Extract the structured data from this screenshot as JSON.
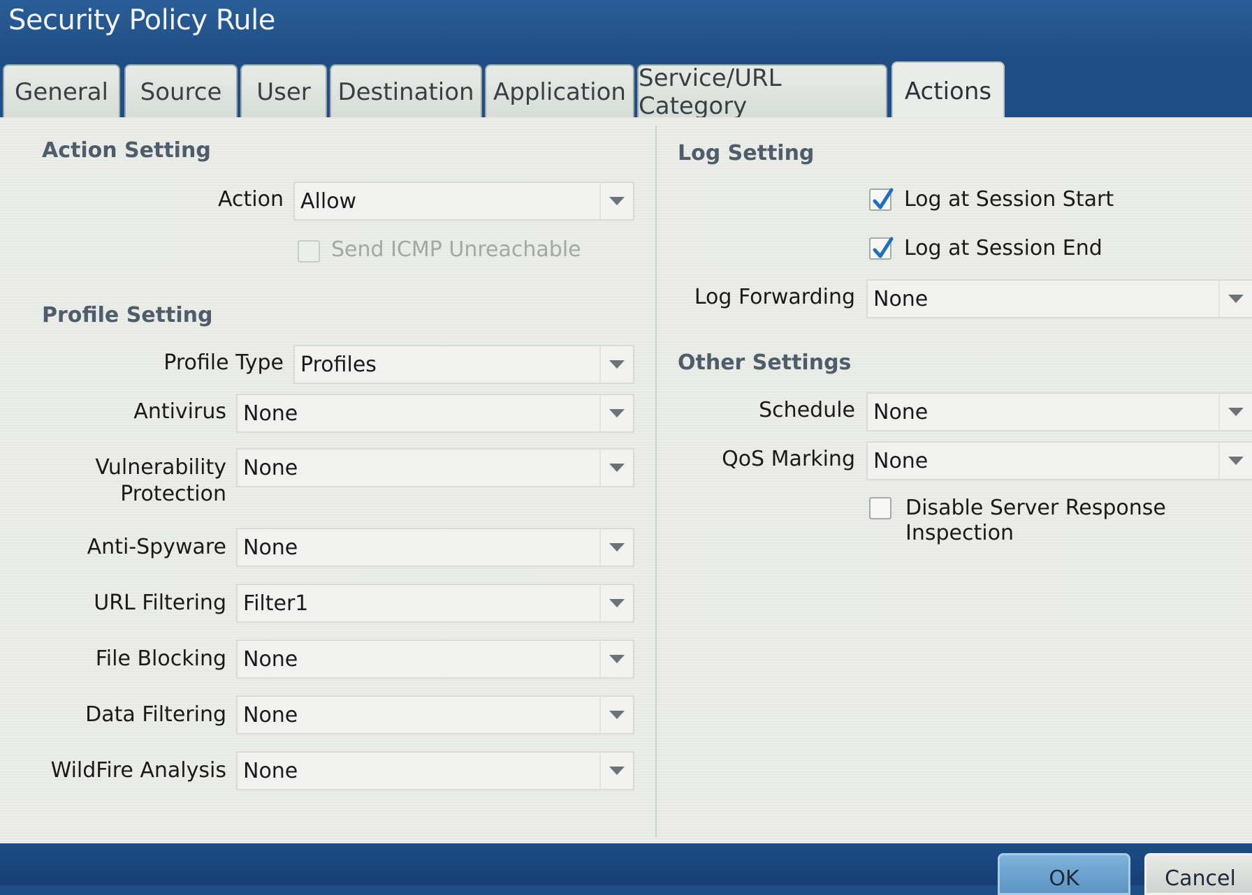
{
  "window": {
    "title": "Security Policy Rule"
  },
  "tabs": [
    {
      "label": "General"
    },
    {
      "label": "Source"
    },
    {
      "label": "User"
    },
    {
      "label": "Destination"
    },
    {
      "label": "Application"
    },
    {
      "label": "Service/URL Category"
    },
    {
      "label": "Actions",
      "active": true
    }
  ],
  "action_setting": {
    "title": "Action Setting",
    "action_label": "Action",
    "action_value": "Allow",
    "send_icmp_label": "Send ICMP Unreachable",
    "send_icmp_checked": false,
    "send_icmp_disabled": true
  },
  "profile_setting": {
    "title": "Profile Setting",
    "profile_type_label": "Profile Type",
    "profile_type_value": "Profiles",
    "antivirus_label": "Antivirus",
    "antivirus_value": "None",
    "vuln_label_1": "Vulnerability",
    "vuln_label_2": "Protection",
    "vuln_value": "None",
    "antispyware_label": "Anti-Spyware",
    "antispyware_value": "None",
    "url_filtering_label": "URL Filtering",
    "url_filtering_value": "Filter1",
    "file_blocking_label": "File Blocking",
    "file_blocking_value": "None",
    "data_filtering_label": "Data Filtering",
    "data_filtering_value": "None",
    "wildfire_label": "WildFire Analysis",
    "wildfire_value": "None"
  },
  "log_setting": {
    "title": "Log Setting",
    "session_start_label": "Log at Session Start",
    "session_start_checked": true,
    "session_end_label": "Log at Session End",
    "session_end_checked": true,
    "forwarding_label": "Log Forwarding",
    "forwarding_value": "None"
  },
  "other_settings": {
    "title": "Other Settings",
    "schedule_label": "Schedule",
    "schedule_value": "None",
    "qos_label": "QoS Marking",
    "qos_value": "None",
    "dsri_label": "Disable Server Response Inspection",
    "dsri_checked": false
  },
  "buttons": {
    "ok": "OK",
    "cancel": "Cancel"
  },
  "colors": {
    "accent": "#1f4d84",
    "check": "#1e6fc0"
  }
}
